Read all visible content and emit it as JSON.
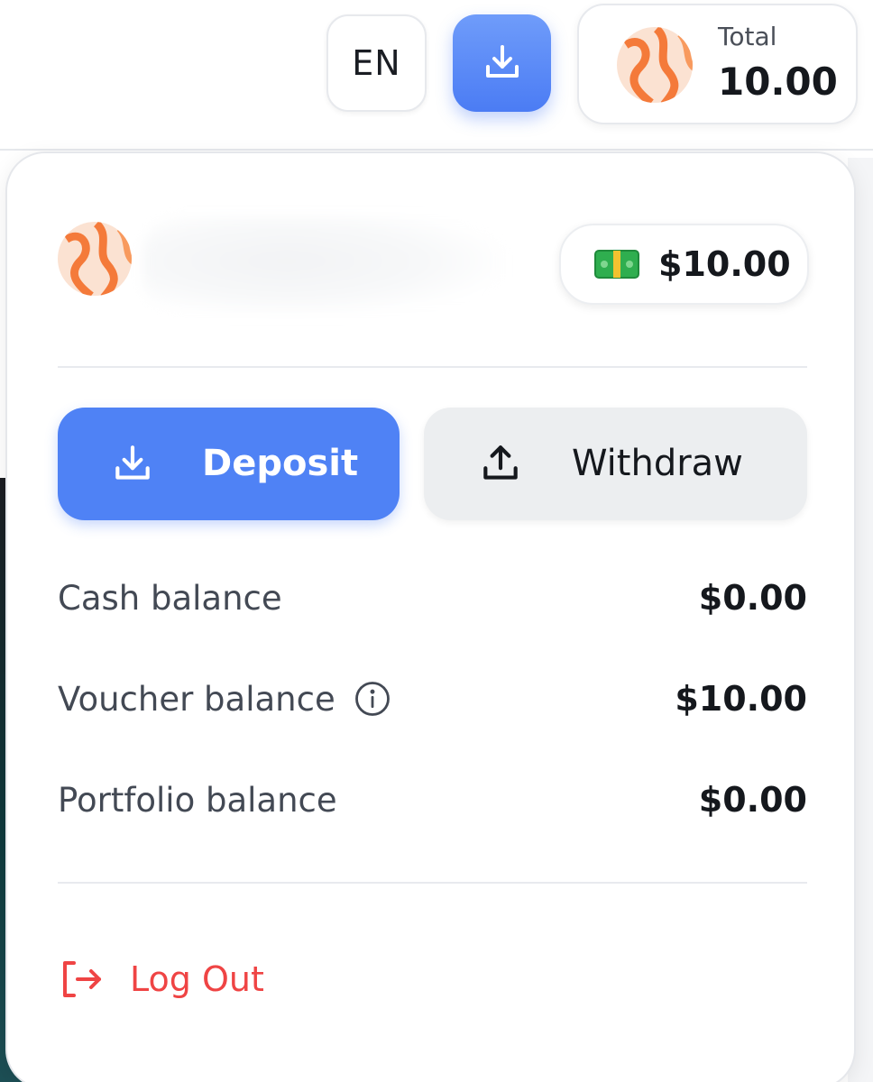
{
  "header": {
    "language": "EN",
    "total": {
      "label": "Total",
      "value": "10.00"
    }
  },
  "panel": {
    "wallet_balance": "$10.00",
    "actions": {
      "deposit": "Deposit",
      "withdraw": "Withdraw"
    },
    "balances": [
      {
        "label": "Cash balance",
        "value": "$0.00",
        "info": false
      },
      {
        "label": "Voucher balance",
        "value": "$10.00",
        "info": true
      },
      {
        "label": "Portfolio balance",
        "value": "$0.00",
        "info": false
      }
    ],
    "logout": "Log Out"
  },
  "colors": {
    "accent": "#4f82f5",
    "danger": "#ef4444",
    "avatar_orange": "#f47a3a",
    "money_green": "#22a447"
  },
  "icons": [
    "download-icon",
    "upload-icon",
    "info-icon",
    "logout-icon",
    "money-icon",
    "avatar-icon"
  ]
}
